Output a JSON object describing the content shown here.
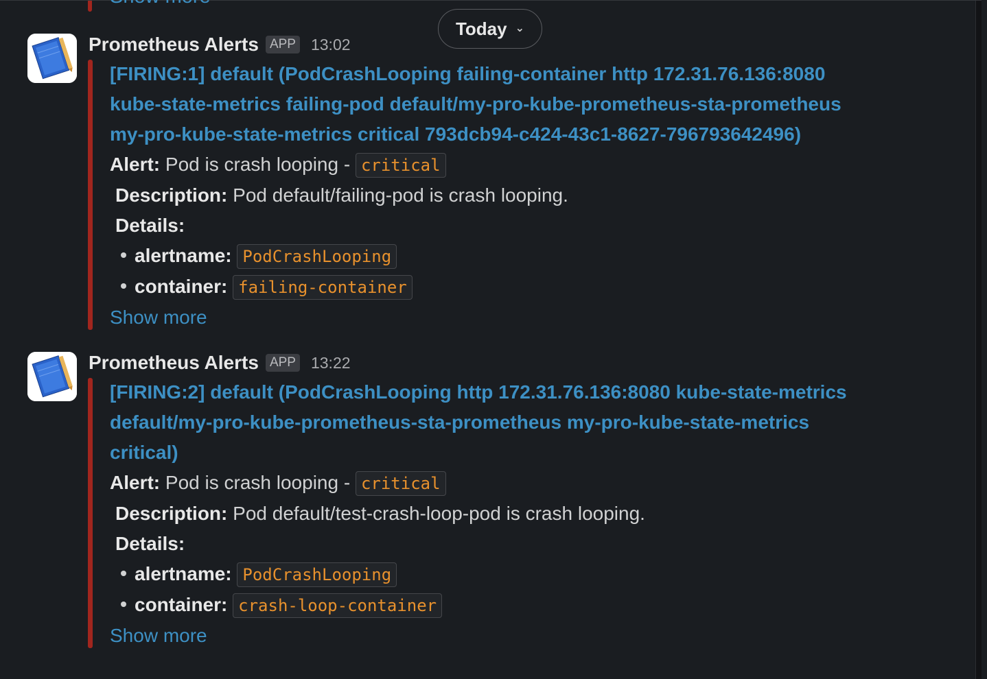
{
  "date_divider": {
    "label": "Today"
  },
  "previous_message": {
    "show_more": "Show more"
  },
  "messages": [
    {
      "sender": "Prometheus Alerts",
      "badge": "APP",
      "time": "13:02",
      "title_lines": [
        "[FIRING:1] default (PodCrashLooping failing-container http 172.31.76.136:8080",
        "kube-state-metrics failing-pod default/my-pro-kube-prometheus-sta-prometheus",
        "my-pro-kube-state-metrics critical 793dcb94-c424-43c1-8627-796793642496)"
      ],
      "alert_label": "Alert:",
      "alert_text": "Pod is crash looping -",
      "severity": "critical",
      "description_label": "Description:",
      "description_text": "Pod default/failing-pod is crash looping.",
      "details_label": "Details:",
      "details": [
        {
          "key": "alertname:",
          "value": "PodCrashLooping"
        },
        {
          "key": "container:",
          "value": "failing-container"
        }
      ],
      "show_more": "Show more"
    },
    {
      "sender": "Prometheus Alerts",
      "badge": "APP",
      "time": "13:22",
      "title_lines": [
        "[FIRING:2] default (PodCrashLooping http 172.31.76.136:8080 kube-state-metrics",
        "default/my-pro-kube-prometheus-sta-prometheus my-pro-kube-state-metrics",
        "critical)"
      ],
      "alert_label": "Alert:",
      "alert_text": "Pod is crash looping -",
      "severity": "critical",
      "description_label": "Description:",
      "description_text": "Pod default/test-crash-loop-pod is crash looping.",
      "details_label": "Details:",
      "details": [
        {
          "key": "alertname:",
          "value": "PodCrashLooping"
        },
        {
          "key": "container:",
          "value": "crash-loop-container"
        }
      ],
      "show_more": "Show more"
    }
  ],
  "colors": {
    "background": "#1a1d21",
    "attachment_bar": "#a1261e",
    "link": "#3d90c4",
    "code": "#e8912d"
  }
}
